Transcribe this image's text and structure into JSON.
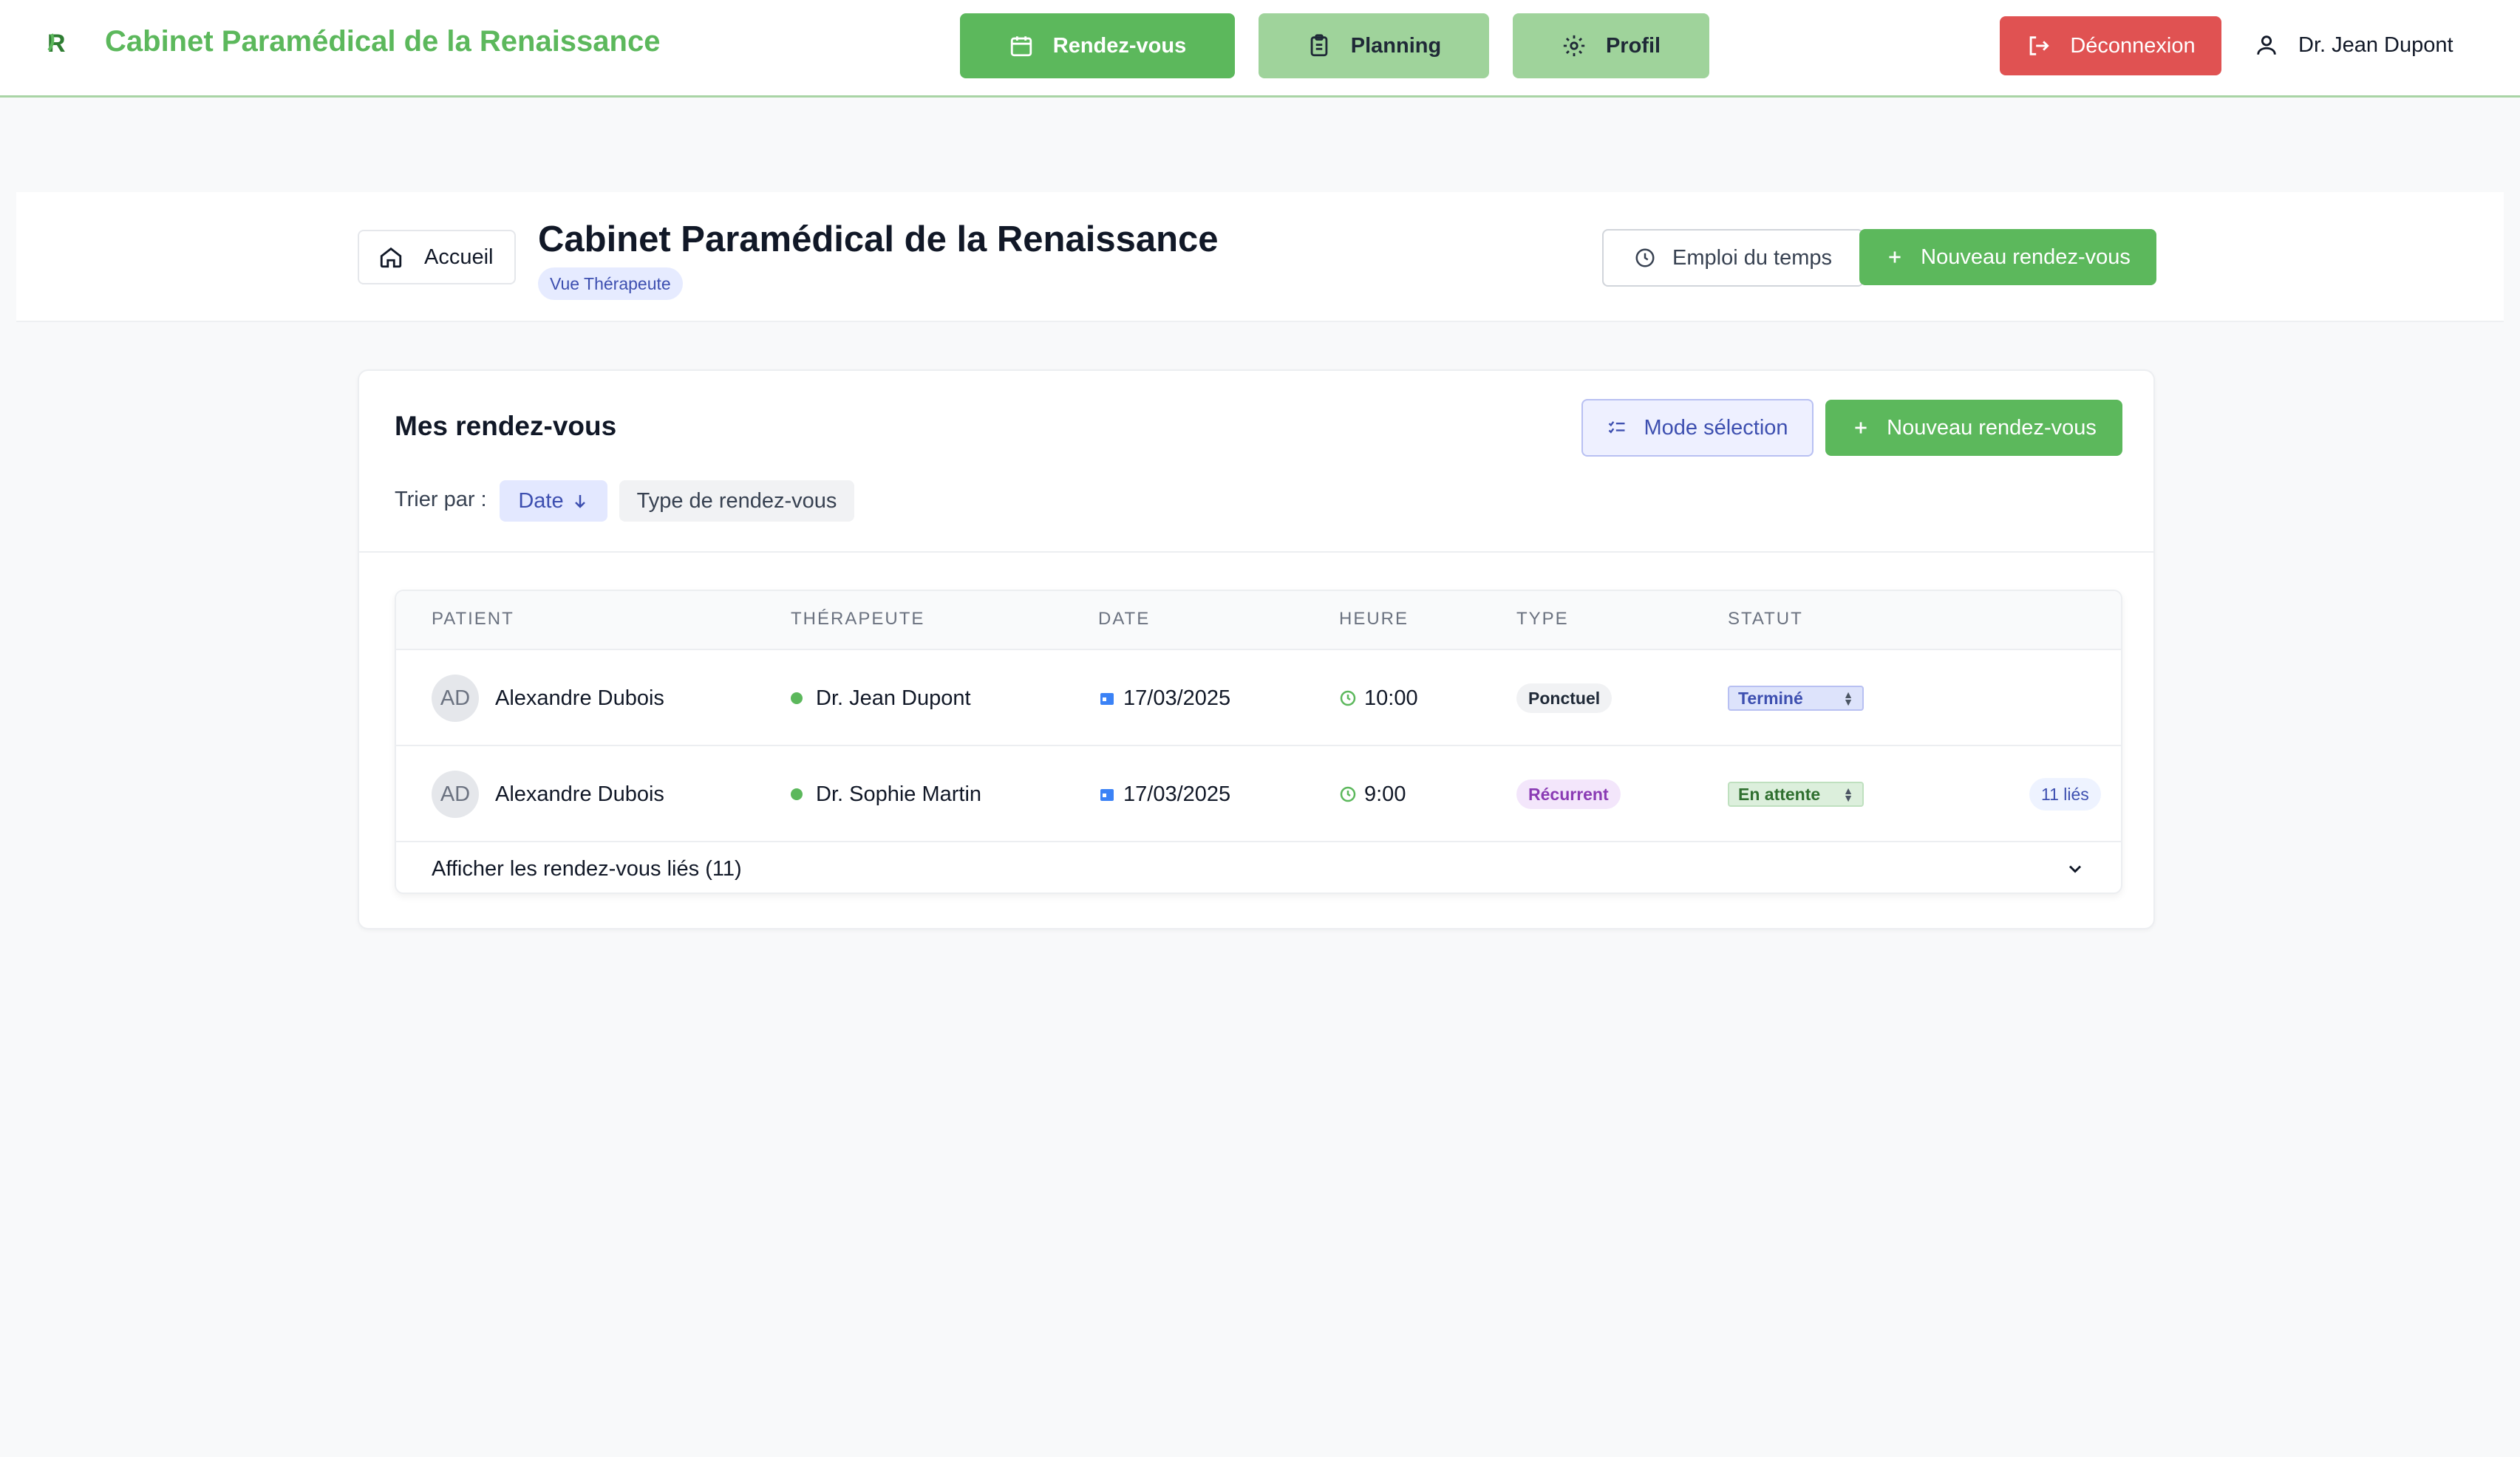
{
  "nav": {
    "app_title": "Cabinet Paramédical de la Renaissance",
    "logo_letter": "R",
    "tabs": [
      {
        "label": "Rendez-vous",
        "icon": "calendar-icon",
        "active": true
      },
      {
        "label": "Planning",
        "icon": "clipboard-icon",
        "active": false
      },
      {
        "label": "Profil",
        "icon": "gear-icon",
        "active": false
      }
    ],
    "logout_label": "Déconnexion",
    "user_name": "Dr. Jean Dupont"
  },
  "header": {
    "home_label": "Accueil",
    "title": "Cabinet Paramédical de la Renaissance",
    "role_badge": "Vue Thérapeute",
    "schedule_label": "Emploi du temps",
    "new_appointment_label": "Nouveau rendez-vous"
  },
  "appointments": {
    "title": "Mes rendez-vous",
    "selection_mode_label": "Mode sélection",
    "new_appointment_label": "Nouveau rendez-vous",
    "sort_label": "Trier par :",
    "sort_options": [
      "Date",
      "Type de rendez-vous"
    ],
    "active_sort": "Date",
    "columns": [
      "PATIENT",
      "THÉRAPEUTE",
      "DATE",
      "HEURE",
      "TYPE",
      "STATUT"
    ],
    "rows": [
      {
        "initials": "AD",
        "patient": "Alexandre Dubois",
        "therapist": "Dr. Jean Dupont",
        "date": "17/03/2025",
        "time": "10:00",
        "type": "Ponctuel",
        "status": "Terminé",
        "linked": ""
      },
      {
        "initials": "AD",
        "patient": "Alexandre Dubois",
        "therapist": "Dr. Sophie Martin",
        "date": "17/03/2025",
        "time": "9:00",
        "type": "Récurrent",
        "status": "En attente",
        "linked": "11 liés"
      }
    ],
    "expand_label": "Afficher les rendez-vous liés (11)"
  },
  "colors": {
    "brand_green": "#5cb85c",
    "light_green": "#9fd39b",
    "danger_red": "#e05252",
    "accent_indigo": "#3d4fb0"
  }
}
